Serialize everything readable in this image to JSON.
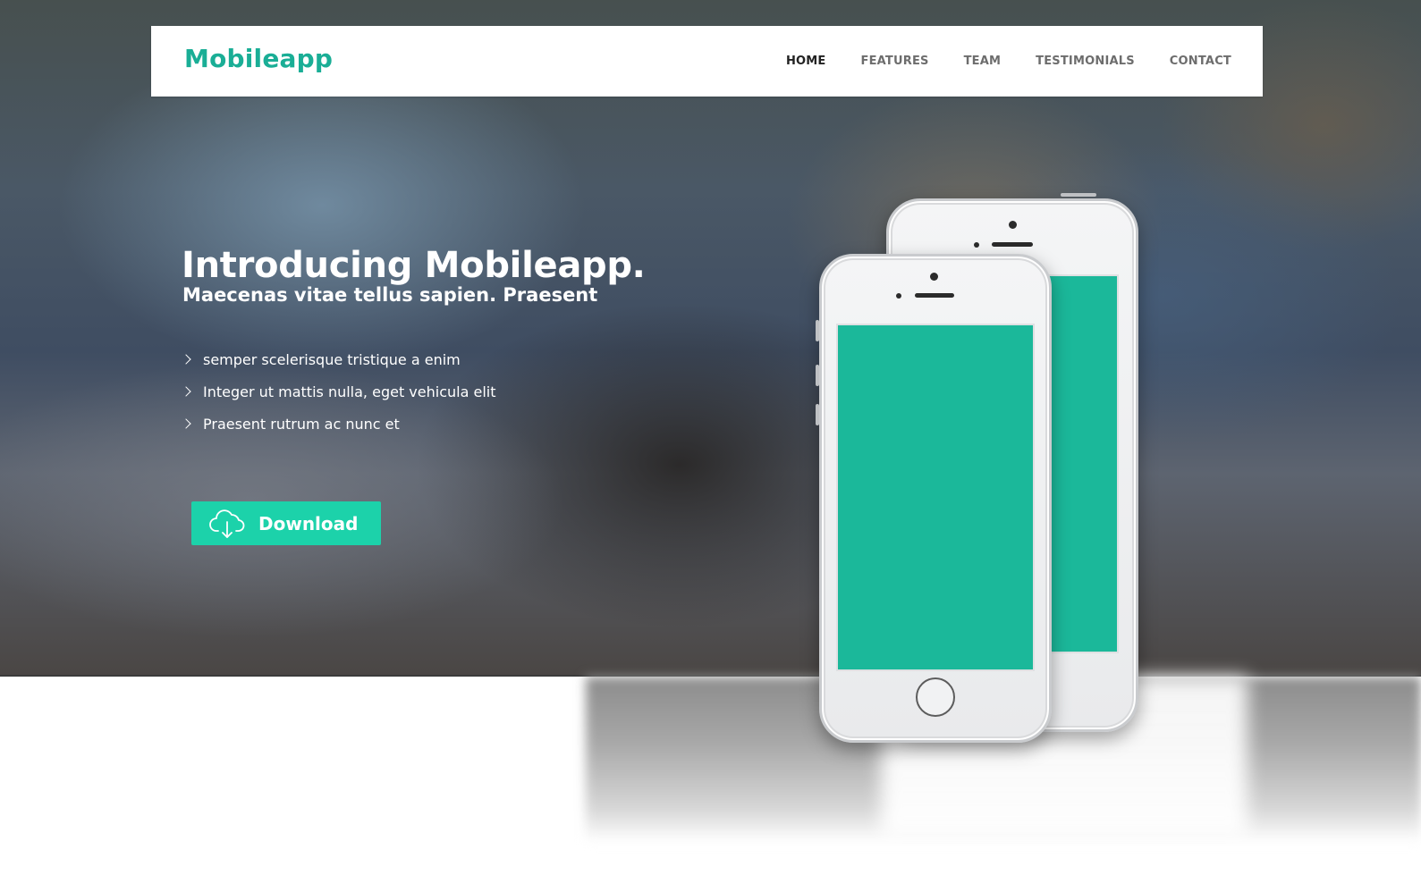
{
  "brand": {
    "name": "Mobileapp",
    "color": "#1aae96"
  },
  "nav": {
    "items": [
      {
        "label": "HOME",
        "active": true
      },
      {
        "label": "FEATURES",
        "active": false
      },
      {
        "label": "TEAM",
        "active": false
      },
      {
        "label": "TESTIMONIALS",
        "active": false
      },
      {
        "label": "CONTACT",
        "active": false
      }
    ]
  },
  "hero": {
    "title": "Introducing Mobileapp.",
    "subtitle": "Maecenas vitae tellus sapien. Praesent",
    "features": [
      "semper scelerisque tristique a enim",
      "Integer ut mattis nulla, eget vehicula elit",
      "Praesent rutrum ac nunc et"
    ],
    "download_button": {
      "label": "Download",
      "icon": "cloud-download-icon",
      "color": "#1cd2aa"
    }
  },
  "phones": {
    "screen_color": "#1bb89a"
  }
}
